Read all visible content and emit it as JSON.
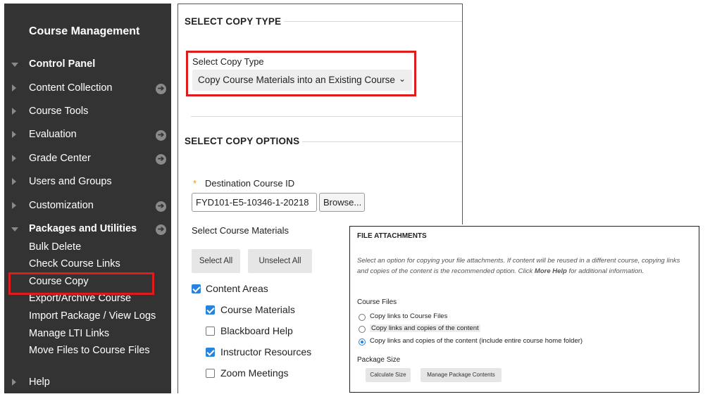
{
  "sidebar": {
    "title": "Course Management",
    "items": [
      {
        "label": "Control Panel",
        "expanded": true,
        "bold": true,
        "arrow": false
      },
      {
        "label": "Content Collection",
        "expanded": false,
        "bold": false,
        "arrow": true
      },
      {
        "label": "Course Tools",
        "expanded": false,
        "bold": false,
        "arrow": false
      },
      {
        "label": "Evaluation",
        "expanded": false,
        "bold": false,
        "arrow": true
      },
      {
        "label": "Grade Center",
        "expanded": false,
        "bold": false,
        "arrow": true
      },
      {
        "label": "Users and Groups",
        "expanded": false,
        "bold": false,
        "arrow": false
      },
      {
        "label": "Customization",
        "expanded": false,
        "bold": false,
        "arrow": true
      },
      {
        "label": "Packages and Utilities",
        "expanded": true,
        "bold": true,
        "arrow": true
      }
    ],
    "sub_items": [
      "Bulk Delete",
      "Check Course Links",
      "Course Copy",
      "Export/Archive Course",
      "Import Package / View Logs",
      "Manage LTI Links",
      "Move Files to Course Files"
    ],
    "help": "Help",
    "arrow_glyph": "➔"
  },
  "copy_type": {
    "section_title": "SELECT COPY TYPE",
    "label": "Select Copy Type",
    "selected": "Copy Course Materials into an Existing Course",
    "chevron": "⌄"
  },
  "copy_options": {
    "section_title": "SELECT COPY OPTIONS",
    "required_star": "*",
    "destination_label": "Destination Course ID",
    "destination_value": "FYD101-E5-10346-1-20218",
    "browse_label": "Browse...",
    "materials_label": "Select Course Materials",
    "select_all": "Select All",
    "unselect_all": "Unselect All",
    "materials": [
      {
        "label": "Content Areas",
        "checked": true,
        "indent": 0
      },
      {
        "label": "Course Materials",
        "checked": true,
        "indent": 1
      },
      {
        "label": "Blackboard Help",
        "checked": false,
        "indent": 1
      },
      {
        "label": "Instructor Resources",
        "checked": true,
        "indent": 1
      },
      {
        "label": "Zoom Meetings",
        "checked": false,
        "indent": 1
      }
    ]
  },
  "file_attachments": {
    "title": "FILE ATTACHMENTS",
    "description_1": "Select an option for copying your file attachments. If content will be reused in a different course, copying links and copies of the content is the recommended option. Click ",
    "description_bold": "More Help",
    "description_2": " for additional information.",
    "course_files_label": "Course Files",
    "options": [
      {
        "label": "Copy links to Course Files",
        "selected": false
      },
      {
        "label": "Copy links and copies of the content",
        "selected": false
      },
      {
        "label": "Copy links and copies of the content (include entire course home folder)",
        "selected": true
      }
    ],
    "package_size_label": "Package Size",
    "calculate_size": "Calculate Size",
    "manage_package": "Manage Package Contents"
  },
  "colors": {
    "sidebar_bg": "#333333",
    "highlight": "#e01b1b",
    "accent": "#2684de"
  }
}
